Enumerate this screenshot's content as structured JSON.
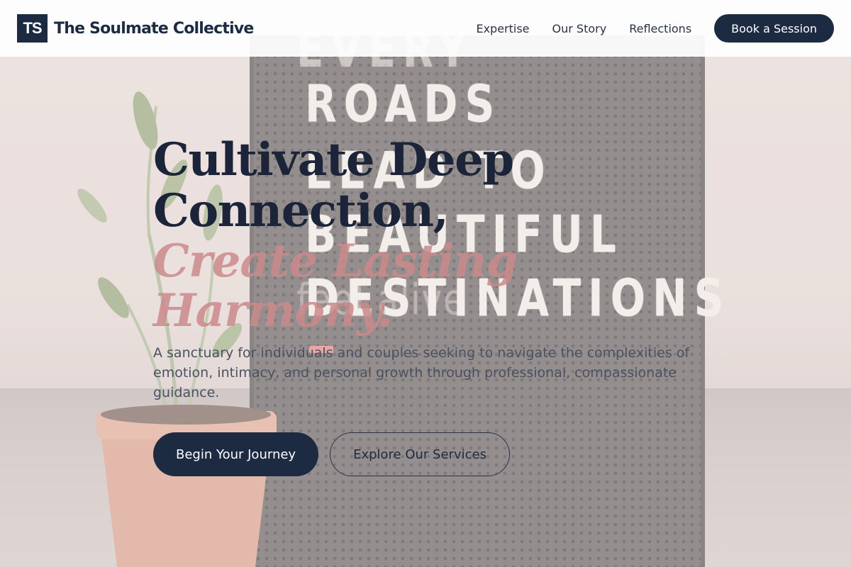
{
  "brand": {
    "logo_mark": "TS",
    "name": "The Soulmate Collective"
  },
  "nav": {
    "links": [
      "Expertise",
      "Our Story",
      "Reflections"
    ],
    "cta_label": "Book a Session"
  },
  "hero": {
    "headline_line1": "Cultivate Deep",
    "headline_line2": "Connection,",
    "accent_line1": "Create Lasting",
    "accent_line2": "Harmony.",
    "description": "A sanctuary for individuals and couples seeking to navigate the complexities of emotion, intimacy, and personal growth through professional, compassionate guidance.",
    "primary_button": "Begin Your Journey",
    "secondary_button": "Explore Our Services",
    "background_image": {
      "board_lines": [
        "EVERY",
        "ROADS",
        "LEAD TO",
        "BEAUTIFUL",
        "DESTINATIONS"
      ],
      "board_faint_text": "feel alive"
    }
  },
  "colors": {
    "navy": "#1d2b42",
    "accent_rose": "#cc8a8c",
    "accent_bar": "#e5797a",
    "body_text": "#4a5161"
  }
}
